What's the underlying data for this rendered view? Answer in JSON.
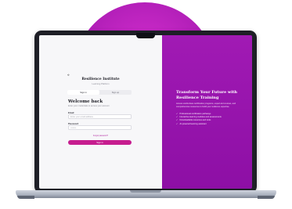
{
  "login": {
    "brand_title": "Resilience Institute",
    "brand_subtitle": "Learning Platform",
    "tabs": [
      {
        "label": "Sign in",
        "active": true
      },
      {
        "label": "Sign up",
        "active": false
      }
    ],
    "heading": "Welcome back",
    "subheading": "Enter your credentials to access your account",
    "email_label": "Email",
    "email_placeholder": "Enter your email address",
    "password_label": "Password",
    "password_placeholder": "••••••••",
    "forgot_link": "Forgot password?",
    "submit_label": "Sign in"
  },
  "promo": {
    "title": "Transform Your Future with Resilience Training",
    "body": "Access world-class certification programs, expert-led courses, and comprehensive resources to build your resilience expertise.",
    "items": [
      "Professional certification pathways",
      "Interactive learning modules and assessments",
      "Downloadable resources and tools",
      "AI-powered learning assistant"
    ]
  },
  "colors": {
    "accent": "#c61d8f",
    "promo_background": "#9b16a8",
    "blob": "#c226c6"
  },
  "icons": {
    "logo": "logo-mark-icon",
    "check": "check-icon"
  }
}
